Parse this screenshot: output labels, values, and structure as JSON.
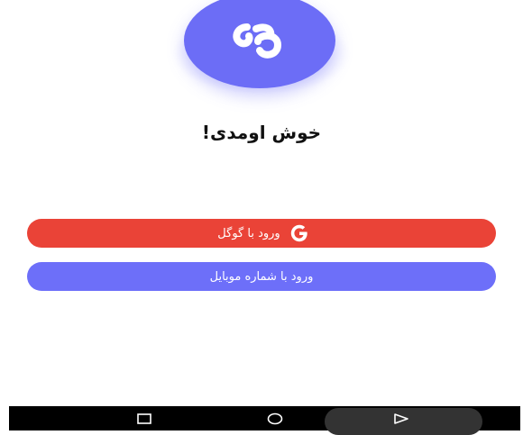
{
  "welcome_title": "خوش اومدی!",
  "buttons": {
    "google_label": "ورود با گوگل",
    "mobile_label": "ورود با شماره موبایل"
  },
  "icons": {
    "logo": "app-logo-icon",
    "google": "google-g-icon",
    "recents": "recents-square-icon",
    "home": "home-circle-icon",
    "back": "back-triangle-icon"
  },
  "colors": {
    "logo_bg": "#6C6DF6",
    "google_button": "#EA4337",
    "mobile_button": "#6D6FF9",
    "navbar": "#000000"
  }
}
